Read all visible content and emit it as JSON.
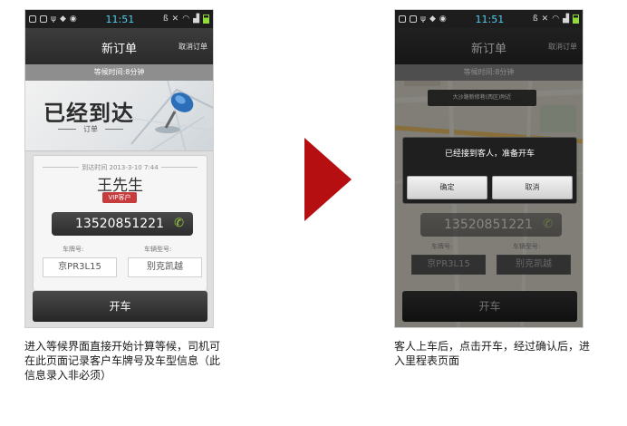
{
  "status_bar": {
    "time": "11:51"
  },
  "screen_left": {
    "title": "新订单",
    "cancel_label": "取消订单",
    "wait_text": "等候时间:8分钟",
    "banner_title": "已经到达",
    "banner_sub": "订单",
    "arrive_time": "到达时间 2013-3-10 7:44",
    "customer_name": "王先生",
    "vip_badge": "VIP客户",
    "phone_number": "13520851221",
    "plate_label": "车牌号:",
    "model_label": "车辆型号:",
    "plate_value": "京PR3L15",
    "model_value": "别克凯越",
    "start_label": "开车"
  },
  "screen_right": {
    "title": "新订单",
    "cancel_label": "取消订单",
    "wait_text": "等候时间:8分钟",
    "map_tip": "大沙路新修巷(西区)附近",
    "dialog_message": "已经接到客人，准备开车",
    "confirm_label": "确定",
    "cancel_label2": "取消",
    "phone_number": "13520851221",
    "plate_label": "车牌号:",
    "model_label": "车辆型号:",
    "plate_value": "京PR3L15",
    "model_value": "别克凯越",
    "start_label": "开车"
  },
  "captions": {
    "left": "进入等候界面直接开始计算等候，司机可在此页面记录客户车牌号及车型信息（此信息录入非必须）",
    "right": "客人上车后，点击开车，经过确认后，进入里程表页面"
  },
  "colors": {
    "accent_red": "#b50f12",
    "phone_green": "#9fd63a",
    "vip_red": "#c63b3b",
    "time_blue": "#4ed0f0"
  }
}
